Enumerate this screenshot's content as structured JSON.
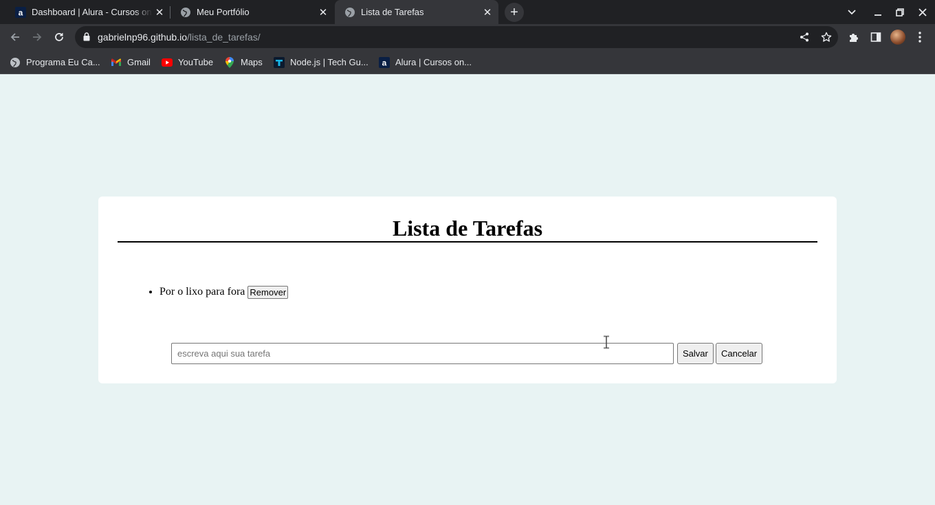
{
  "browser": {
    "tabs": [
      {
        "title": "Dashboard | Alura - Cursos online de tecnologia",
        "favicon": "alura-icon",
        "active": false
      },
      {
        "title": "Meu Portfólio",
        "favicon": "globe-icon",
        "active": false
      },
      {
        "title": "Lista de Tarefas",
        "favicon": "globe-icon",
        "active": true
      }
    ],
    "url": {
      "host": "gabrielnp96.github.io",
      "path": "/lista_de_tarefas/"
    },
    "bookmarks": [
      {
        "label": "Programa Eu Ca...",
        "icon": "globe-icon"
      },
      {
        "label": "Gmail",
        "icon": "gmail-icon"
      },
      {
        "label": "YouTube",
        "icon": "youtube-icon"
      },
      {
        "label": "Maps",
        "icon": "maps-icon"
      },
      {
        "label": "Node.js | Tech Gu...",
        "icon": "techguide-icon"
      },
      {
        "label": "Alura | Cursos on...",
        "icon": "alura-icon"
      }
    ]
  },
  "page": {
    "title": "Lista de Tarefas",
    "tasks": [
      {
        "text": "Por o lixo para fora",
        "remove_label": "Remover"
      }
    ],
    "form": {
      "input_value": "",
      "input_placeholder": "escreva aqui sua tarefa",
      "save_label": "Salvar",
      "cancel_label": "Cancelar"
    }
  },
  "colors": {
    "page_background": "#e8f3f3",
    "card_background": "#ffffff",
    "chrome_dark": "#202124",
    "chrome_toolbar": "#35363a"
  }
}
